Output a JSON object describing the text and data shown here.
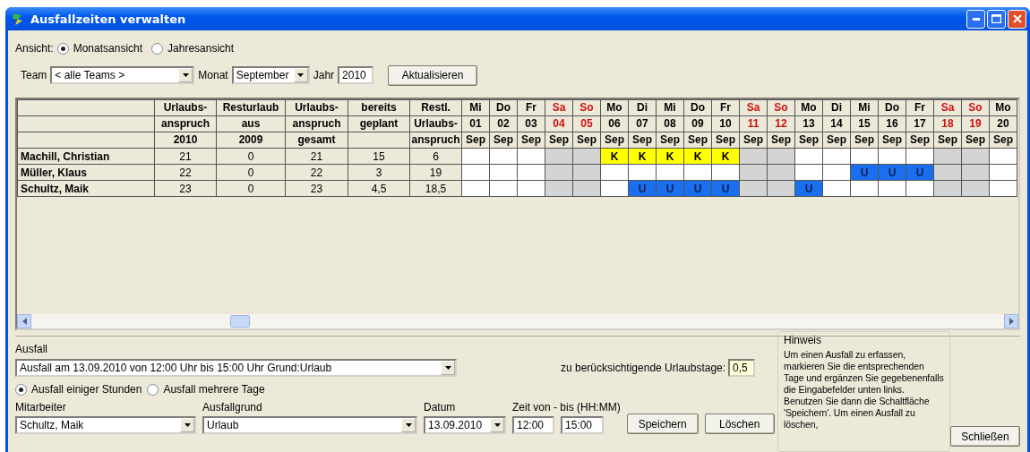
{
  "window": {
    "title": "Ausfallzeiten verwalten"
  },
  "view": {
    "label": "Ansicht:",
    "options": [
      {
        "label": "Monatsansicht",
        "selected": true
      },
      {
        "label": "Jahresansicht",
        "selected": false
      }
    ]
  },
  "filter": {
    "team_label": "Team",
    "team": "< alle Teams >",
    "month_label": "Monat",
    "month": "September",
    "year_label": "Jahr",
    "year": "2010",
    "button": "Aktualisieren"
  },
  "table": {
    "columns": [
      {
        "lines": [
          "Urlaubs-",
          "anspruch",
          "2010"
        ]
      },
      {
        "lines": [
          "Resturlaub",
          "aus",
          "2009"
        ]
      },
      {
        "lines": [
          "Urlaubs-",
          "anspruch",
          "gesamt"
        ]
      },
      {
        "lines": [
          "bereits",
          "geplant"
        ]
      },
      {
        "lines": [
          "Restl.",
          "Urlaubs-",
          "anspruch"
        ]
      }
    ],
    "days": [
      {
        "weekday": "Mi",
        "day": "01",
        "month": "Sep",
        "weekend": false
      },
      {
        "weekday": "Do",
        "day": "02",
        "month": "Sep",
        "weekend": false
      },
      {
        "weekday": "Fr",
        "day": "03",
        "month": "Sep",
        "weekend": false
      },
      {
        "weekday": "Sa",
        "day": "04",
        "month": "Sep",
        "weekend": true
      },
      {
        "weekday": "So",
        "day": "05",
        "month": "Sep",
        "weekend": true
      },
      {
        "weekday": "Mo",
        "day": "06",
        "month": "Sep",
        "weekend": false
      },
      {
        "weekday": "Di",
        "day": "07",
        "month": "Sep",
        "weekend": false
      },
      {
        "weekday": "Mi",
        "day": "08",
        "month": "Sep",
        "weekend": false
      },
      {
        "weekday": "Do",
        "day": "09",
        "month": "Sep",
        "weekend": false
      },
      {
        "weekday": "Fr",
        "day": "10",
        "month": "Sep",
        "weekend": false
      },
      {
        "weekday": "Sa",
        "day": "11",
        "month": "Sep",
        "weekend": true
      },
      {
        "weekday": "So",
        "day": "12",
        "month": "Sep",
        "weekend": true
      },
      {
        "weekday": "Mo",
        "day": "13",
        "month": "Sep",
        "weekend": false
      },
      {
        "weekday": "Di",
        "day": "14",
        "month": "Sep",
        "weekend": false
      },
      {
        "weekday": "Mi",
        "day": "15",
        "month": "Sep",
        "weekend": false
      },
      {
        "weekday": "Do",
        "day": "16",
        "month": "Sep",
        "weekend": false
      },
      {
        "weekday": "Fr",
        "day": "17",
        "month": "Sep",
        "weekend": false
      },
      {
        "weekday": "Sa",
        "day": "18",
        "month": "Sep",
        "weekend": true
      },
      {
        "weekday": "So",
        "day": "19",
        "month": "Sep",
        "weekend": true
      },
      {
        "weekday": "Mo",
        "day": "20",
        "month": "Sep",
        "weekend": false
      }
    ],
    "rows": [
      {
        "name": "Machill, Christian",
        "values": [
          "21",
          "0",
          "21",
          "15",
          "6"
        ],
        "cells": [
          {
            "kind": "none"
          },
          {
            "kind": "none"
          },
          {
            "kind": "none"
          },
          {
            "kind": "none"
          },
          {
            "kind": "none"
          },
          {
            "kind": "sick",
            "code": "K"
          },
          {
            "kind": "sick",
            "code": "K"
          },
          {
            "kind": "sick",
            "code": "K"
          },
          {
            "kind": "sick",
            "code": "K"
          },
          {
            "kind": "sick",
            "code": "K"
          },
          {
            "kind": "none"
          },
          {
            "kind": "none"
          },
          {
            "kind": "none"
          },
          {
            "kind": "none"
          },
          {
            "kind": "none"
          },
          {
            "kind": "none"
          },
          {
            "kind": "none"
          },
          {
            "kind": "none"
          },
          {
            "kind": "none"
          },
          {
            "kind": "none"
          }
        ]
      },
      {
        "name": "Müller, Klaus",
        "values": [
          "22",
          "0",
          "22",
          "3",
          "19"
        ],
        "cells": [
          {
            "kind": "none"
          },
          {
            "kind": "none"
          },
          {
            "kind": "none"
          },
          {
            "kind": "none"
          },
          {
            "kind": "none"
          },
          {
            "kind": "none"
          },
          {
            "kind": "none"
          },
          {
            "kind": "none"
          },
          {
            "kind": "none"
          },
          {
            "kind": "none"
          },
          {
            "kind": "none"
          },
          {
            "kind": "none"
          },
          {
            "kind": "none"
          },
          {
            "kind": "none"
          },
          {
            "kind": "vacation",
            "code": "U"
          },
          {
            "kind": "vacation",
            "code": "U"
          },
          {
            "kind": "vacation",
            "code": "U"
          },
          {
            "kind": "none"
          },
          {
            "kind": "none"
          },
          {
            "kind": "none"
          }
        ]
      },
      {
        "name": "Schultz, Maik",
        "values": [
          "23",
          "0",
          "23",
          "4,5",
          "18,5"
        ],
        "cells": [
          {
            "kind": "none"
          },
          {
            "kind": "none"
          },
          {
            "kind": "none"
          },
          {
            "kind": "none"
          },
          {
            "kind": "none"
          },
          {
            "kind": "none"
          },
          {
            "kind": "vacation",
            "code": "U"
          },
          {
            "kind": "vacation",
            "code": "U"
          },
          {
            "kind": "vacation",
            "code": "U"
          },
          {
            "kind": "vacation",
            "code": "U"
          },
          {
            "kind": "none"
          },
          {
            "kind": "none"
          },
          {
            "kind": "vacation",
            "code": "U"
          },
          {
            "kind": "none"
          },
          {
            "kind": "none"
          },
          {
            "kind": "none"
          },
          {
            "kind": "none"
          },
          {
            "kind": "none"
          },
          {
            "kind": "none"
          },
          {
            "kind": "none"
          }
        ]
      }
    ]
  },
  "absence": {
    "label": "Ausfall",
    "selection": "Ausfall am 13.09.2010 von 12:00 Uhr bis 15:00 Uhr Grund:Urlaub",
    "days_label": "zu berücksichtigende Urlaubstage:",
    "days_value": "0,5",
    "modes": [
      {
        "label": "Ausfall einiger Stunden",
        "selected": true
      },
      {
        "label": "Ausfall mehrere Tage",
        "selected": false
      }
    ],
    "employee_label": "Mitarbeiter",
    "employee": "Schultz, Maik",
    "reason_label": "Ausfallgrund",
    "reason": "Urlaub",
    "date_label": "Datum",
    "date": "13.09.2010",
    "time_label": "Zeit von - bis (HH:MM)",
    "time_from": "12:00",
    "time_to": "15:00",
    "save": "Speichern",
    "delete": "Löschen"
  },
  "hint": {
    "title": "Hinweis",
    "text": "Um einen Ausfall zu erfassen, markieren Sie die entsprechenden Tage und ergänzen Sie gegebenenfalls die Eingabefelder unten links. Benutzen Sie dann die Schaltfläche 'Speichern'. Um einen Ausfall zu löschen,"
  },
  "close_button": "Schließen"
}
